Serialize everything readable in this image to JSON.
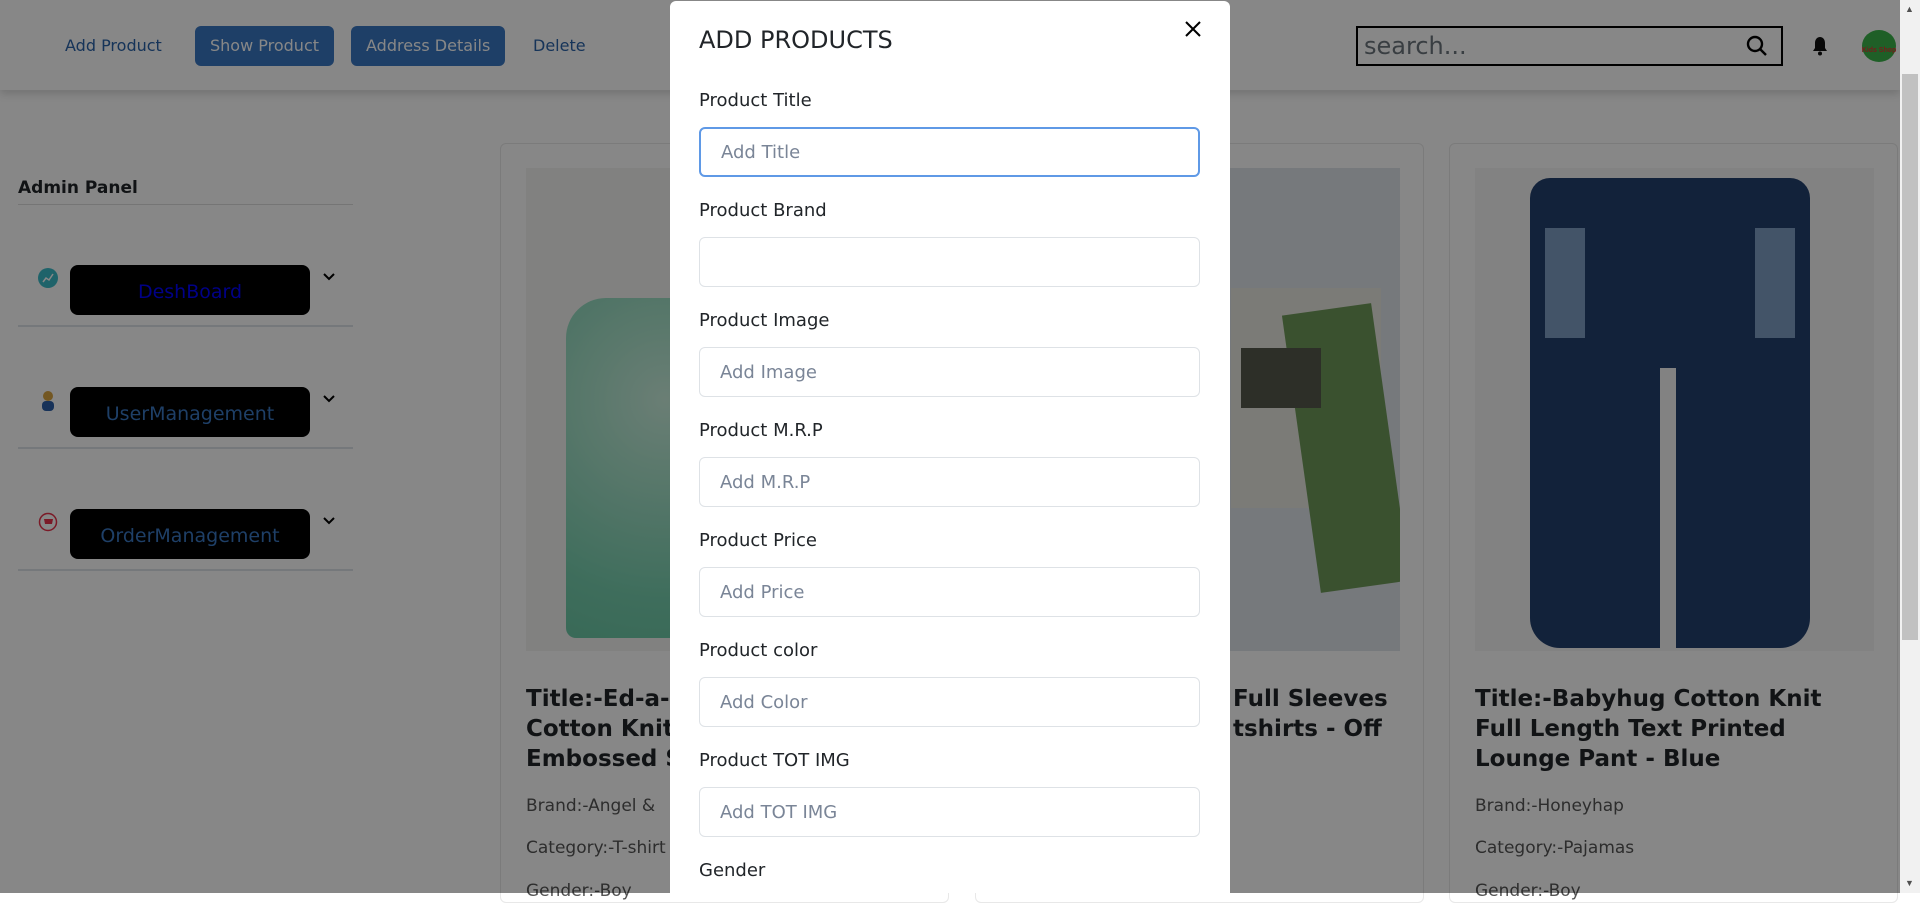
{
  "navbar": {
    "links": [
      {
        "label": "Add Product",
        "style": "link"
      },
      {
        "label": "Show Product",
        "style": "button"
      },
      {
        "label": "Address Details",
        "style": "button"
      },
      {
        "label": "Delete",
        "style": "link"
      }
    ],
    "search_placeholder": "search...",
    "search_icon": "magnifier-icon",
    "bell_icon": "bell-icon",
    "avatar_logo_text": "Kids Shop"
  },
  "sidebar": {
    "title": "Admin Panel",
    "items": [
      {
        "label": "DeshBoard",
        "icon": "chart-icon",
        "color": "#0000ff"
      },
      {
        "label": "UserManagement",
        "icon": "user-icon",
        "color": "#3a78c2"
      },
      {
        "label": "OrderManagement",
        "icon": "cart-icon",
        "color": "#3a78c2"
      }
    ]
  },
  "products": [
    {
      "title_lines": [
        "Title:-Ed-a-M",
        "Cotton Knit",
        "Embossed Sw"
      ],
      "brand": "Brand:-Angel & ",
      "category": "Category:-T-shirt",
      "gender": "Gender:-Boy"
    },
    {
      "title_lines": [
        "Full Sleeves",
        "tshirts - Off"
      ]
    },
    {
      "title": "Title:-Babyhug Cotton Knit Full Length Text Printed Lounge Pant - Blue",
      "brand": "Brand:-Honeyhap",
      "category": "Category:-Pajamas",
      "gender": "Gender:-Boy"
    }
  ],
  "modal": {
    "title": "ADD PRODUCTS",
    "close_icon": "close-icon",
    "fields": [
      {
        "label": "Product Title",
        "placeholder": "Add Title",
        "value": ""
      },
      {
        "label": "Product Brand",
        "placeholder": "",
        "value": ""
      },
      {
        "label": "Product Image",
        "placeholder": "Add Image",
        "value": ""
      },
      {
        "label": "Product M.R.P",
        "placeholder": "Add M.R.P",
        "value": ""
      },
      {
        "label": "Product Price",
        "placeholder": "Add Price",
        "value": ""
      },
      {
        "label": "Product color",
        "placeholder": "Add Color",
        "value": ""
      },
      {
        "label": "Product TOT IMG",
        "placeholder": "Add TOT IMG",
        "value": ""
      }
    ],
    "gender_label": "Gender"
  }
}
